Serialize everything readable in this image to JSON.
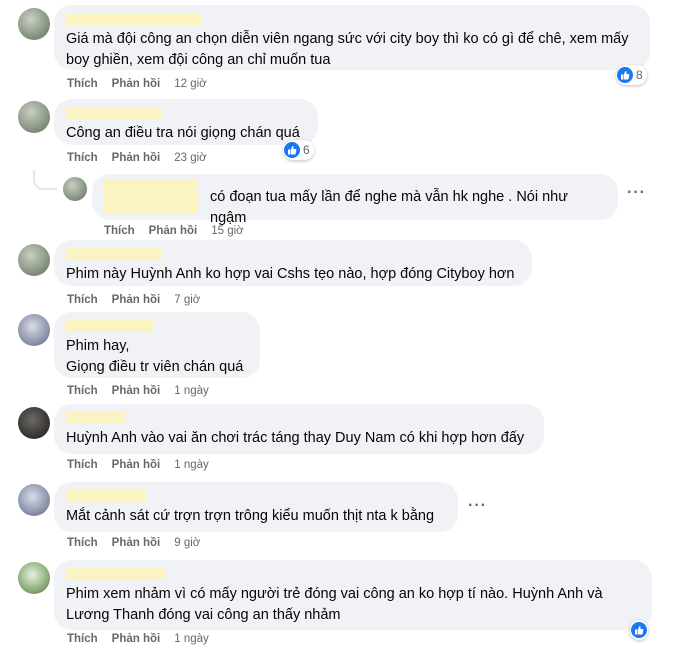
{
  "comments": [
    {
      "text": "Giá mà đội công an chọn diễn viên ngang sức với city boy thì ko có gì để chê, xem mấy boy ghiền, xem đội công an chỉ muốn tua",
      "like": "Thích",
      "reply": "Phản hồi",
      "time": "12 giờ",
      "reaction_count": "8"
    },
    {
      "text": "Công an điều tra nói giọng chán quá",
      "like": "Thích",
      "reply": "Phản hồi",
      "time": "23 giờ",
      "reaction_count": "6"
    },
    {
      "text": "có đoạn tua mấy lần để nghe mà vẫn hk nghe . Nói như ngậm",
      "like": "Thích",
      "reply": "Phản hồi",
      "time": "15 giờ"
    },
    {
      "text": "Phim này Huỳnh Anh ko hợp vai Cshs tẹo nào, hợp đóng Cityboy hơn",
      "like": "Thích",
      "reply": "Phản hồi",
      "time": "7 giờ"
    },
    {
      "text": "Phim hay,\nGiọng điều tr viên chán quá",
      "like": "Thích",
      "reply": "Phản hồi",
      "time": "1 ngày"
    },
    {
      "text": "Huỳnh Anh vào vai ăn chơi trác táng thay Duy Nam có khi hợp hơn đấy",
      "like": "Thích",
      "reply": "Phản hồi",
      "time": "1 ngày"
    },
    {
      "text": "Mắt cảnh sát cứ trợn trợn trông kiểu muốn thịt nta k bằng",
      "like": "Thích",
      "reply": "Phản hồi",
      "time": "9 giờ"
    },
    {
      "text": "Phim xem nhảm vì có mấy người trẻ đóng vai công an ko hợp tí nào. Huỳnh Anh và Lương Thanh đóng vai công an thấy nhảm",
      "like": "Thích",
      "reply": "Phản hồi",
      "time": "1 ngày"
    }
  ],
  "icons": {
    "like": "like-icon",
    "more": "more-options-icon"
  },
  "colors": {
    "bubble": "#f0f2f5",
    "like_blue": "#1877f2",
    "meta_text": "#65676b",
    "hidden_name": "#fbf3c2"
  },
  "more_label": "···"
}
